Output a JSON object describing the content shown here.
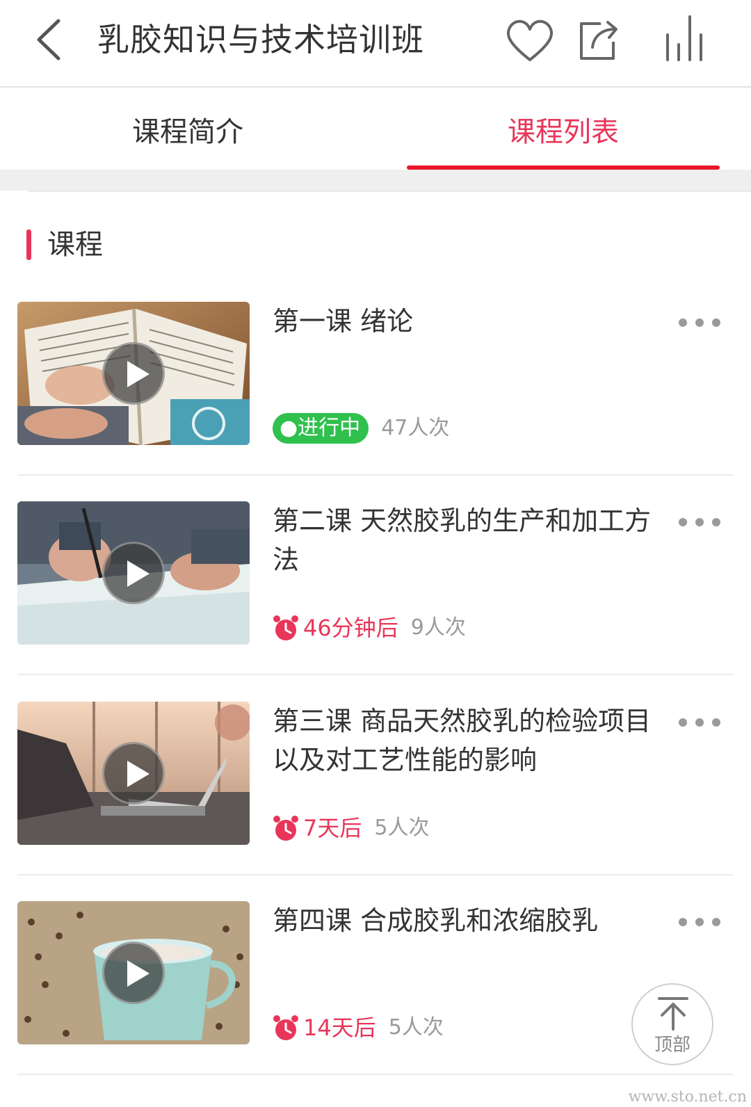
{
  "header": {
    "title": "乳胶知识与技术培训班"
  },
  "tabs": {
    "intro": "课程简介",
    "list": "课程列表",
    "active": "list"
  },
  "section": {
    "title": "课程"
  },
  "lessons": [
    {
      "title": "第一课 绪论",
      "status": "●进行中",
      "status_type": "live",
      "views": "47人次",
      "thumb": "open-book"
    },
    {
      "title": "第二课 天然胶乳的生产和加工方法",
      "status": "46分钟后",
      "status_type": "scheduled",
      "views": "9人次",
      "thumb": "writing-hand"
    },
    {
      "title": "第三课 商品天然胶乳的检验项目以及对工艺性能的影响",
      "status": "7天后",
      "status_type": "scheduled",
      "views": "5人次",
      "thumb": "laptop-window"
    },
    {
      "title": "第四课  合成胶乳和浓缩胶乳",
      "status": "14天后",
      "status_type": "scheduled",
      "views": "5人次",
      "thumb": "coffee-cup"
    }
  ],
  "back_to_top": {
    "label": "顶部"
  },
  "watermark": "www.sto.net.cn",
  "colors": {
    "accent": "#e8365a",
    "tab_underline": "#e8182b",
    "live": "#2fc04d",
    "muted": "#9a9a9a"
  }
}
